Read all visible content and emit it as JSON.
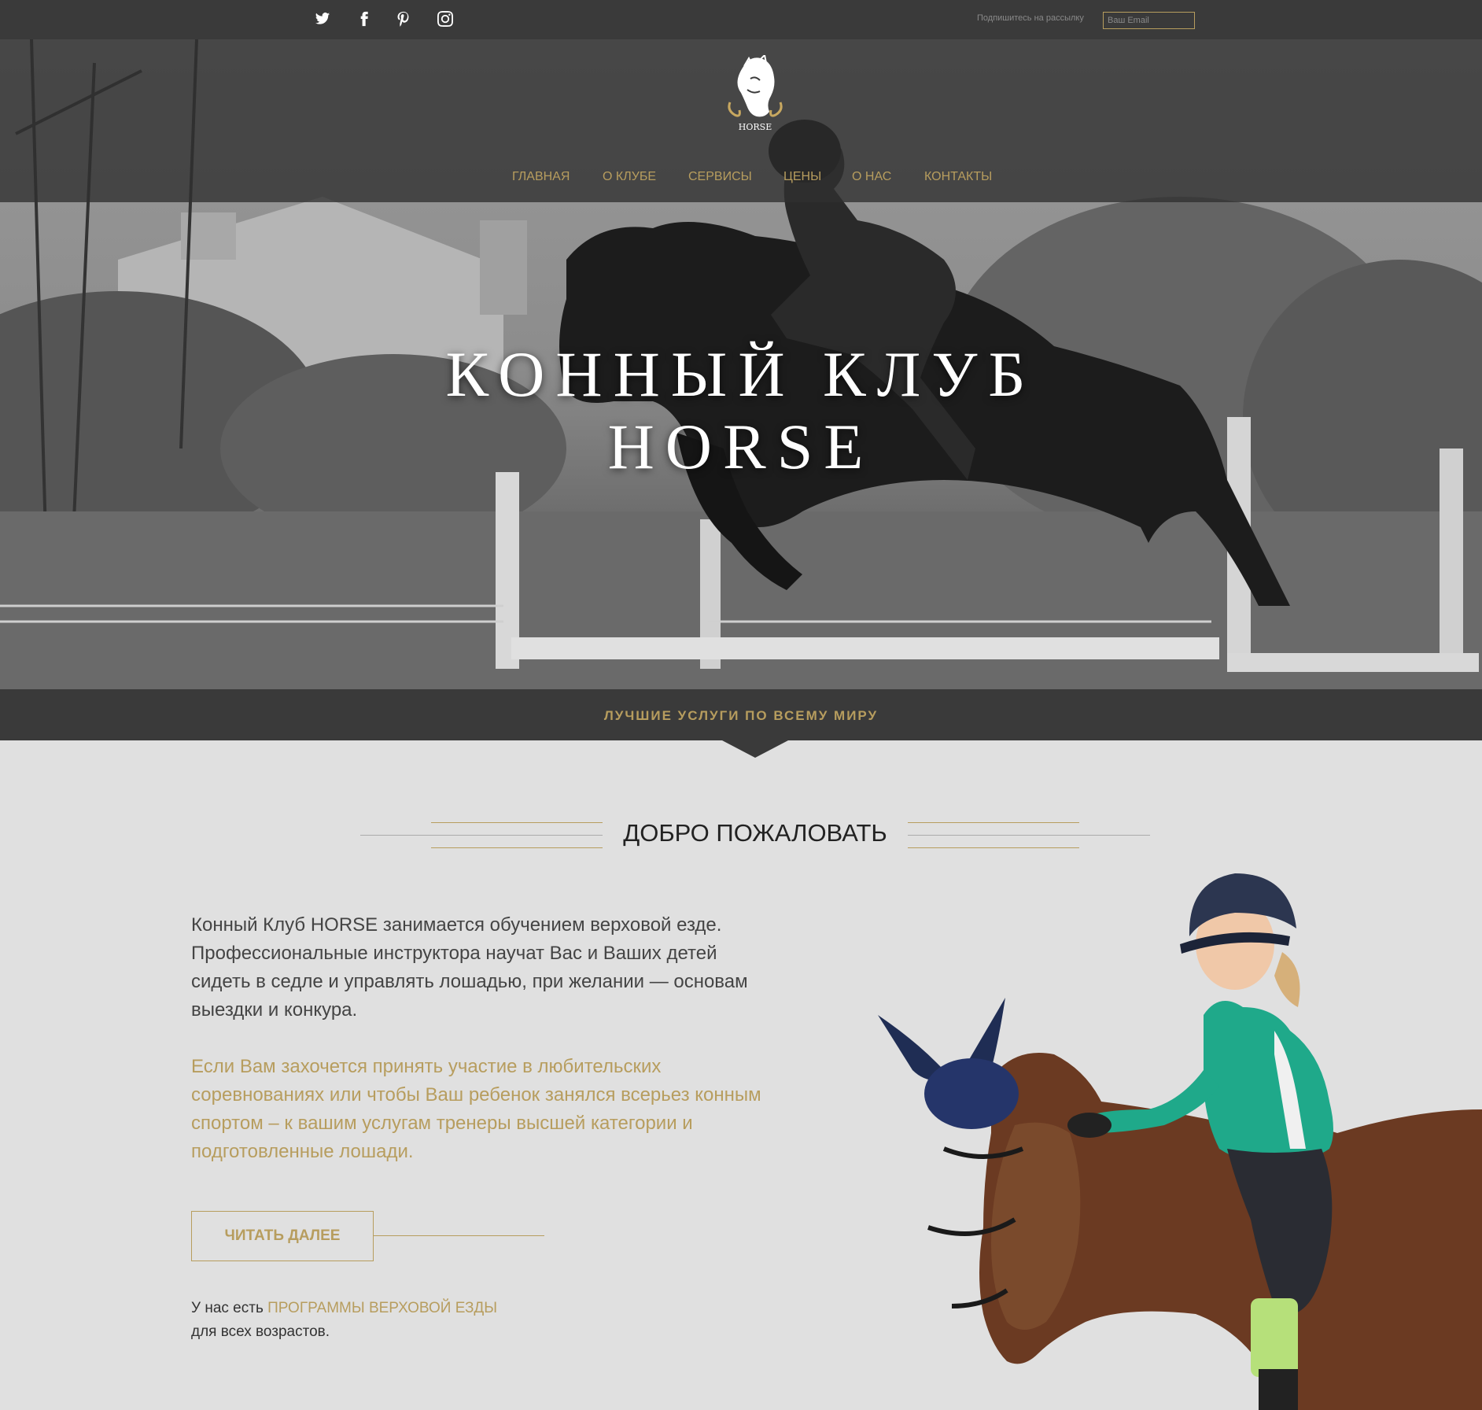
{
  "topbar": {
    "social": [
      {
        "name": "twitter-icon",
        "label": "twitter"
      },
      {
        "name": "facebook-icon",
        "label": "facebook"
      },
      {
        "name": "pinterest-icon",
        "label": "pinterest"
      },
      {
        "name": "instagram-icon",
        "label": "instagram"
      }
    ],
    "subscribe_label": "Подпишитесь на рассылку",
    "email_placeholder": "Ваш Email"
  },
  "logo": {
    "text": "HORSE"
  },
  "nav": {
    "items": [
      {
        "label": "ГЛАВНАЯ"
      },
      {
        "label": "О КЛУБЕ"
      },
      {
        "label": "СЕРВИСЫ"
      },
      {
        "label": "ЦЕНЫ"
      },
      {
        "label": "О НАС"
      },
      {
        "label": "КОНТАКТЫ"
      }
    ]
  },
  "hero": {
    "title_line1": "КОННЫЙ КЛУБ",
    "title_line2": "HORSE"
  },
  "strip": {
    "text": "ЛУЧШИЕ УСЛУГИ ПО ВСЕМУ МИРУ"
  },
  "welcome": {
    "title": "ДОБРО ПОЖАЛОВАТЬ",
    "para1": "Конный Клуб HORSE занимается обучением верховой езде. Профессиональные инструктора научат Вас и Ваших детей сидеть в седле и управлять лошадью, при желании — основам выездки и конкура.",
    "para2": "Если Вам захочется принять участие в любительских соревнованиях или чтобы Ваш ребенок занялся всерьез конным спортом – к вашим услугам тренеры высшей категории и подготовленные лошади.",
    "read_more": "ЧИТАТЬ ДАЛЕЕ",
    "programs_prefix": "У нас есть ",
    "programs_link": "ПРОГРАММЫ ВЕРХОВОЙ ЕЗДЫ",
    "programs_suffix": "для всех возрастов."
  },
  "colors": {
    "accent": "#b79d5e",
    "dark": "#3a3a3a",
    "background": "#e0e0e0"
  }
}
